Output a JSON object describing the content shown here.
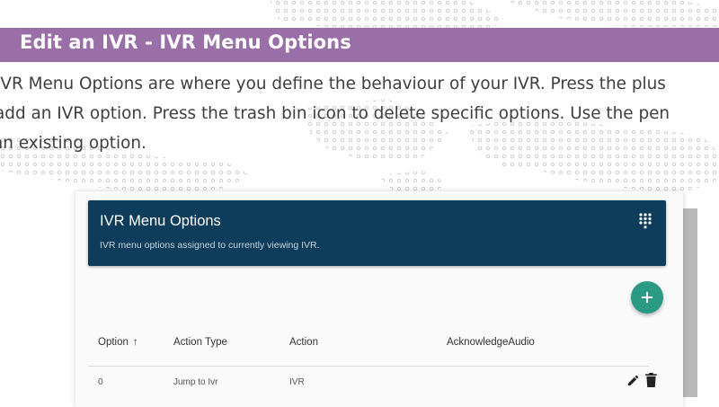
{
  "document": {
    "title": "Edit an IVR - IVR Menu Options",
    "intro_lines": [
      "IVR Menu Options are where you define the behaviour of your IVR. Press the plus",
      "add an IVR option. Press the trash bin icon to delete specific options. Use the pen",
      "an existing option."
    ]
  },
  "panel": {
    "title": "IVR Menu Options",
    "subtitle": "IVR menu options assigned to currently viewing IVR.",
    "dialpad_icon": "dialpad-icon",
    "add_icon": "plus-icon"
  },
  "table": {
    "headers": {
      "option": "Option",
      "action_type": "Action Type",
      "action": "Action",
      "acknowledge_audio": "AcknowledgeAudio"
    },
    "sort_arrow": "↑",
    "rows": [
      {
        "option": "0",
        "action_type": "Jump to Ivr",
        "action": "IVR",
        "acknowledge_audio": ""
      }
    ],
    "row_icons": [
      "pencil-icon",
      "trash-icon"
    ]
  },
  "colors": {
    "title_band": "#9a6fa8",
    "panel_header": "#0e3d5c",
    "add_button": "#2a9a84"
  }
}
